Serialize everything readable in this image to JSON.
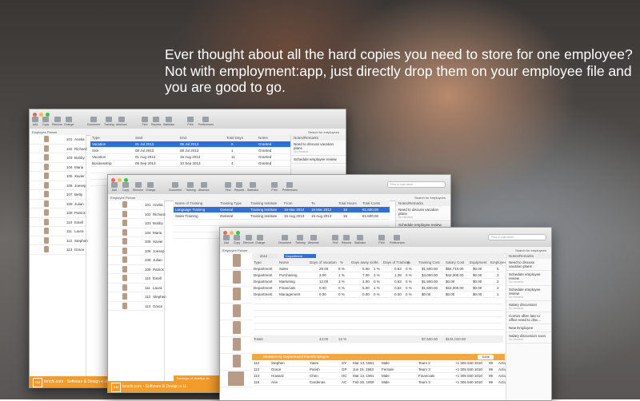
{
  "headline": "Ever thought about all the hard copies you need to store for one employee?\nNot with employment:app, just directly drop them on your employee file and\nyou are good to go.",
  "toolbar": {
    "add": "Add",
    "copy": "Copy",
    "remove": "Remove",
    "change": "Change",
    "document": "Document",
    "training": "Training",
    "absence": "Absence",
    "find": "Find",
    "reports": "Reports",
    "statistics": "Statistics",
    "print": "Print",
    "preferences": "Preferences",
    "search_placeholder": "First or Last name",
    "search_employees": "Search for employees"
  },
  "win1": {
    "people_header": "Employee Picture",
    "people": [
      {
        "no": "101",
        "name": "Anelia"
      },
      {
        "no": "102",
        "name": "Richard"
      },
      {
        "no": "103",
        "name": "Bobby"
      },
      {
        "no": "104",
        "name": "Maria"
      },
      {
        "no": "105",
        "name": "Xavier"
      },
      {
        "no": "106",
        "name": "Joesep"
      },
      {
        "no": "107",
        "name": "Betty"
      },
      {
        "no": "108",
        "name": "Julian"
      },
      {
        "no": "109",
        "name": "Patrick"
      },
      {
        "no": "110",
        "name": "Estell"
      },
      {
        "no": "111",
        "name": "Laura"
      },
      {
        "no": "112",
        "name": "Stephen"
      },
      {
        "no": "113",
        "name": "Grace"
      }
    ],
    "abs_headers": [
      "Type",
      "Start",
      "End",
      "Total Days",
      "Notes"
    ],
    "absences": [
      {
        "type": "Vacation",
        "start": "01 Jul 2013",
        "end": "05 Jul 2013",
        "days": "5",
        "note": "Granted"
      },
      {
        "type": "Sick",
        "start": "08 Jul 2013",
        "end": "08 Jul 2013",
        "days": "1",
        "note": "Granted"
      },
      {
        "type": "Vacation",
        "start": "01 Aug 2013",
        "end": "15 Aug 2013",
        "days": "11",
        "note": "Granted"
      },
      {
        "type": "Businesstrip",
        "start": "05 Sep 2013",
        "end": "10 Sep 2013",
        "days": "4",
        "note": "Granted"
      }
    ],
    "notes_header": "Notes/Remarks",
    "notes": [
      {
        "text": "Need to discuss vacation plans",
        "sub": "No remarks"
      },
      {
        "text": "Schedule employee review",
        "sub": ""
      }
    ],
    "footer": "tenchi.com - Software & Design e.U."
  },
  "win2": {
    "train_headers": [
      "Name of Training",
      "Training Type",
      "Training Institute",
      "From",
      "To",
      "Total Hours",
      "Total Costs"
    ],
    "trainings": [
      {
        "name": "Language Training",
        "type": "General",
        "inst": "Training Institute",
        "from": "16 Mar 2012",
        "to": "16 Mar 2012",
        "hours": "16",
        "cost": "€1.600,00"
      },
      {
        "name": "Sales Training",
        "type": "General",
        "inst": "Training Institute",
        "from": "15 Aug 2013",
        "to": "15 Aug 2013",
        "hours": "16",
        "cost": "€1.600,00"
      }
    ],
    "footer_label": "Trainings of: Anelica Ju...",
    "footer": "tenchi.com - Software & Design e.U."
  },
  "win3": {
    "year": "2013",
    "dept": "Department",
    "stat_headers": [
      "Type",
      "Name",
      "Days of Vacation",
      "%",
      "Days away sick",
      "%",
      "Days of Training",
      "%",
      "Training Cost",
      "Salary Cost",
      "Equipment",
      "Employees",
      "%"
    ],
    "stats": [
      {
        "type": "Department",
        "name": "Sales",
        "vac": "29.00",
        "vp": "8 %",
        "sick": "5.00",
        "sp": "1 %",
        "tr": "0.63",
        "tp": "0 %",
        "tc": "$1,500.00",
        "sc": "$56,710.00",
        "eq": "$0.00",
        "emp": "5",
        "ep": "33 %"
      },
      {
        "type": "Department",
        "name": "Purchasing",
        "vac": "3.00",
        "vp": "1 %",
        "sick": "7.00",
        "sp": "2 %",
        "tr": "1.38",
        "tp": "0 %",
        "tc": "$3,000.00",
        "sc": "$42,300.00",
        "eq": "$0.00",
        "emp": "3",
        "ep": "20 %"
      },
      {
        "type": "Department",
        "name": "Marketing",
        "vac": "12.00",
        "vp": "3 %",
        "sick": "2.00",
        "sp": "0 %",
        "tr": "0.63",
        "tp": "0 %",
        "tc": "$1,500.00",
        "sc": "$0.00",
        "eq": "$0.00",
        "emp": "2",
        "ep": "13 %"
      },
      {
        "type": "Department",
        "name": "Financials",
        "vac": "0.00",
        "vp": "0 %",
        "sick": "5.00",
        "sp": "1 %",
        "tr": "0.62",
        "tp": "0 %",
        "tc": "$1,500.00",
        "sc": "$32,000.00",
        "eq": "$0.00",
        "emp": "4",
        "ep": "27 %"
      },
      {
        "type": "Department",
        "name": "Management",
        "vac": "0.00",
        "vp": "0 %",
        "sick": "0.00",
        "sp": "0 %",
        "tr": "0.00",
        "tp": "0 %",
        "tc": "$0.00",
        "sc": "$0.00",
        "eq": "$0.00",
        "emp": "1",
        "ep": "7 %"
      }
    ],
    "totals": {
      "label": "Totals",
      "vac": "44.00",
      "vp": "12 %",
      "tc": "$7,500.00",
      "sc": "$131,010.00"
    },
    "stats_label": "Statistics by Department/Team/Employee",
    "done": "Done",
    "people": [
      {
        "no": "112",
        "first": "Stephen",
        "last": "Yates",
        "st": "SY",
        "date": "Mar 14, 1961",
        "sex": "Male",
        "team": "Team 2",
        "phone": "+1 305 840 1010",
        "ext": "99",
        "status": "Active"
      },
      {
        "no": "113",
        "first": "Grace",
        "last": "Parish",
        "st": "GP",
        "date": "Jun 15, 1963",
        "sex": "Female",
        "team": "Team 3",
        "phone": "+1 305 840 1010",
        "ext": "99",
        "status": "Active"
      },
      {
        "no": "114",
        "first": "Howard",
        "last": "Chen",
        "st": "HC",
        "date": "Mar 14, 1961",
        "sex": "Male",
        "team": "Financials",
        "phone": "+1 305 840 1010",
        "ext": "99",
        "status": "Active"
      },
      {
        "no": "115",
        "first": "Arie",
        "last": "Cardenas",
        "st": "AC",
        "date": "Feb 26, 1959",
        "sex": "Male",
        "team": "Team 3",
        "phone": "+1 305 840 1010",
        "ext": "99",
        "status": "Active"
      }
    ],
    "notes": [
      {
        "text": "Need to discuss vacation plans",
        "sub": ""
      },
      {
        "text": "Schedule employee review",
        "sub": "No remarks"
      },
      {
        "text": "Schedule employee review",
        "sub": "No remarks"
      },
      {
        "text": "Salary discussion",
        "sub": "No remarks"
      },
      {
        "text": "Comes often late to office need to disc...",
        "sub": ""
      },
      {
        "text": "New Employee",
        "sub": ""
      },
      {
        "text": "Salary discussion soon",
        "sub": "No remarks"
      }
    ]
  }
}
